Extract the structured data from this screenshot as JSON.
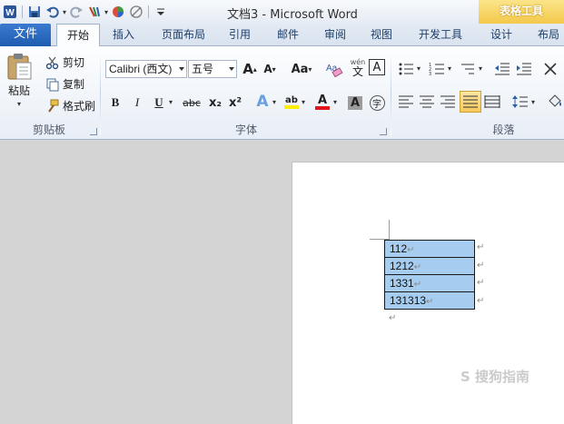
{
  "window": {
    "title": "文档3 - Microsoft Word",
    "context_tab_group": "表格工具"
  },
  "quick_access": [
    "word-app-icon",
    "save-icon",
    "undo-icon",
    "redo-icon",
    "format-painter-icon",
    "color-icon",
    "eraser-icon",
    "customize-icon"
  ],
  "tabs": {
    "file": "文件",
    "items": [
      "开始",
      "插入",
      "页面布局",
      "引用",
      "邮件",
      "审阅",
      "视图",
      "开发工具",
      "设计",
      "布局"
    ],
    "active": "开始"
  },
  "clipboard": {
    "label": "剪贴板",
    "paste": "粘贴",
    "cut": "剪切",
    "copy": "复制",
    "format_painter": "格式刷"
  },
  "font": {
    "label": "字体",
    "font_name": "Calibri (西文)",
    "font_size": "五号",
    "grow": "A",
    "shrink": "A",
    "change_case": "Aa",
    "phonetic": "wén",
    "bold": "B",
    "italic": "I",
    "underline": "U",
    "strike": "abc",
    "subscript": "x₂",
    "superscript": "x²",
    "highlight": "ab",
    "font_color": "A",
    "char_shading": "A",
    "enclose": "字"
  },
  "paragraph": {
    "label": "段落"
  },
  "document": {
    "table_rows": [
      "112",
      "1212",
      "1331",
      "131313"
    ],
    "paragraph_mark": "↵",
    "watermark": "S 搜狗指南"
  }
}
